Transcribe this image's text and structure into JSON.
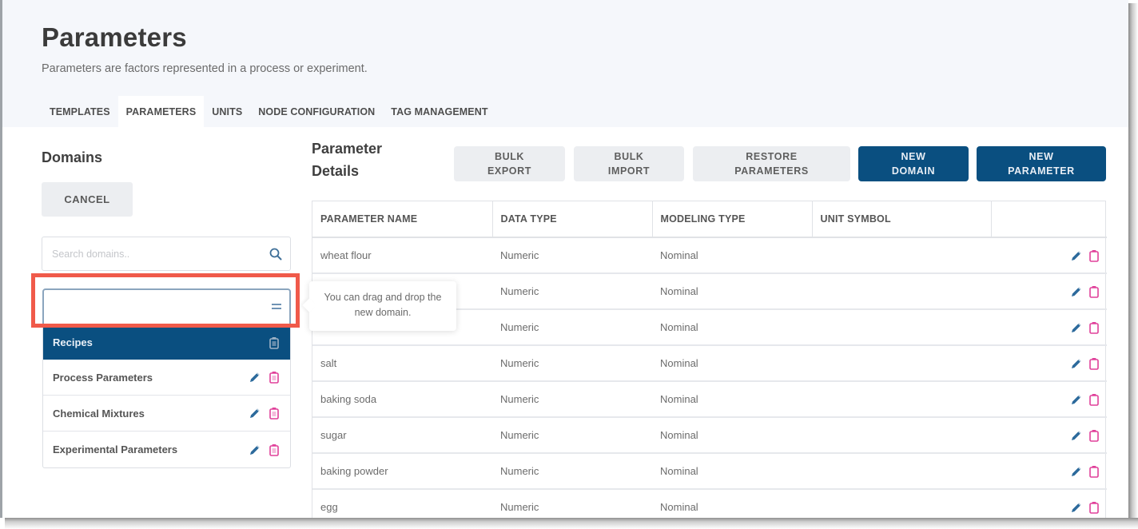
{
  "header": {
    "title": "Parameters",
    "subtitle": "Parameters are factors represented in a process or experiment."
  },
  "tabs": [
    {
      "label": "TEMPLATES",
      "active": false
    },
    {
      "label": "PARAMETERS",
      "active": true
    },
    {
      "label": "UNITS",
      "active": false
    },
    {
      "label": "NODE CONFIGURATION",
      "active": false
    },
    {
      "label": "TAG MANAGEMENT",
      "active": false
    }
  ],
  "domains": {
    "title": "Domains",
    "cancel_label": "CANCEL",
    "search_placeholder": "Search domains..",
    "new_domain_value": "",
    "tooltip": "You can drag and drop the new domain.",
    "items": [
      {
        "label": "Recipes",
        "selected": true
      },
      {
        "label": "Process Parameters",
        "selected": false
      },
      {
        "label": "Chemical Mixtures",
        "selected": false
      },
      {
        "label": "Experimental Parameters",
        "selected": false
      }
    ]
  },
  "details": {
    "title": "Parameter Details",
    "buttons": {
      "bulk_export": "BULK\nEXPORT",
      "bulk_import": "BULK\nIMPORT",
      "restore_parameters": "RESTORE\nPARAMETERS",
      "new_domain": "NEW\nDOMAIN",
      "new_parameter": "NEW\nPARAMETER"
    },
    "columns": [
      "PARAMETER NAME",
      "DATA TYPE",
      "MODELING TYPE",
      "UNIT SYMBOL",
      ""
    ],
    "rows": [
      {
        "name": "wheat flour",
        "data_type": "Numeric",
        "modeling_type": "Nominal",
        "unit_symbol": ""
      },
      {
        "name": "",
        "data_type": "Numeric",
        "modeling_type": "Nominal",
        "unit_symbol": ""
      },
      {
        "name": "",
        "data_type": "Numeric",
        "modeling_type": "Nominal",
        "unit_symbol": ""
      },
      {
        "name": "salt",
        "data_type": "Numeric",
        "modeling_type": "Nominal",
        "unit_symbol": ""
      },
      {
        "name": "baking soda",
        "data_type": "Numeric",
        "modeling_type": "Nominal",
        "unit_symbol": ""
      },
      {
        "name": "sugar",
        "data_type": "Numeric",
        "modeling_type": "Nominal",
        "unit_symbol": ""
      },
      {
        "name": "baking powder",
        "data_type": "Numeric",
        "modeling_type": "Nominal",
        "unit_symbol": ""
      },
      {
        "name": "egg",
        "data_type": "Numeric",
        "modeling_type": "Nominal",
        "unit_symbol": ""
      }
    ]
  },
  "colors": {
    "primary": "#0a4f80",
    "highlight": "#f05a4a",
    "edit_icon": "#2c6a9c",
    "delete_icon": "#e0409a",
    "header_bg": "#f5f7fb"
  }
}
